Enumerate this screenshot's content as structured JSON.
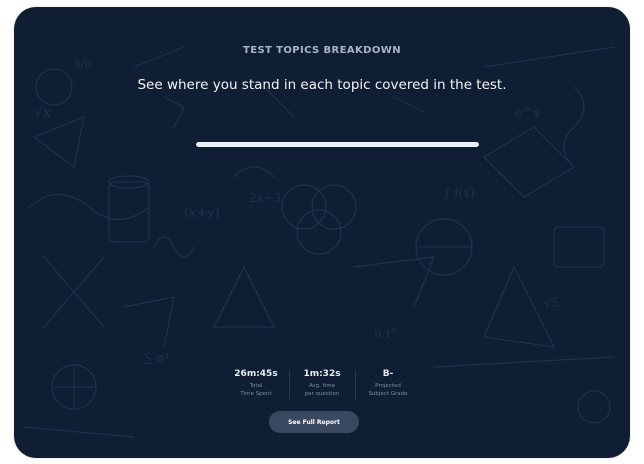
{
  "header": {
    "eyebrow": "TEST TOPICS BREAKDOWN",
    "subtitle": "See where you stand in each topic covered in the test."
  },
  "progress": {
    "value": 1.0
  },
  "stats": [
    {
      "value": "26m:45s",
      "label_line1": "Total",
      "label_line2": "Time Spent"
    },
    {
      "value": "1m:32s",
      "label_line1": "Avg. time",
      "label_line2": "per question"
    },
    {
      "value": "B-",
      "label_line1": "Projected",
      "label_line2": "Subject Grade"
    }
  ],
  "actions": {
    "report_label": "See Full Report"
  },
  "colors": {
    "background": "#0f1e33",
    "progress": "#e9f1fb",
    "button": "#3a4860"
  }
}
